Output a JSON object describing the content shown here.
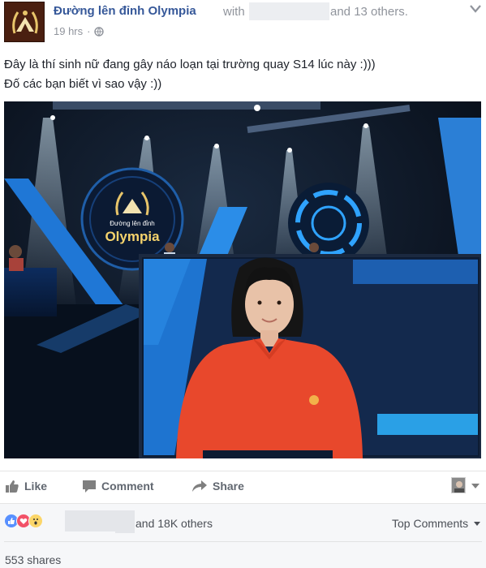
{
  "header": {
    "page_name": "Đường lên đỉnh Olympia",
    "with_label": "with",
    "others_label": "and 13 others.",
    "timestamp": "19 hrs",
    "separator": "·"
  },
  "post": {
    "line1": "Đây là thí sinh nữ đang gây náo loạn tại trường quay S14 lúc này :)))",
    "line2": "Đố các bạn biết vì sao vậy :))"
  },
  "photo": {
    "logo_line": "Đường lên đỉnh",
    "logo_brand": "Olympia"
  },
  "actions": {
    "like": "Like",
    "comment": "Comment",
    "share": "Share"
  },
  "reactions": {
    "types": [
      "like-icon",
      "love-icon",
      "wow-icon"
    ],
    "count_label": "and 18K others",
    "top_comments": "Top Comments",
    "shares": "553 shares"
  },
  "colors": {
    "link": "#365899",
    "meta": "#90949c",
    "like_blue": "#5890ff",
    "love_red": "#f25268",
    "wow_yellow": "#fcd669",
    "shirt": "#e8482c"
  }
}
